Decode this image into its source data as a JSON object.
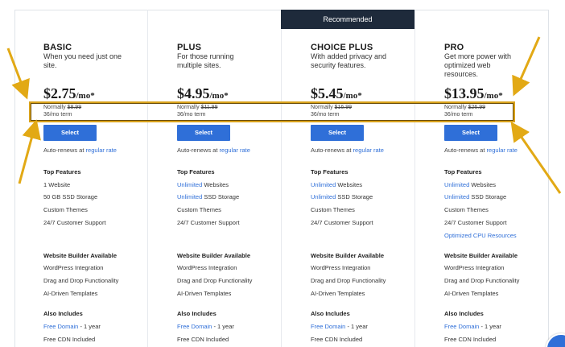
{
  "banner": {
    "recommended": "Recommended"
  },
  "plans": [
    {
      "name": "BASIC",
      "desc": "When you need just one site.",
      "price": "$2.75",
      "per": "/mo*",
      "normally_label": "Normally",
      "normally_price": "$8.99",
      "term": "36/mo term",
      "select": "Select",
      "auto_prefix": "Auto-renews at",
      "auto_link": "regular rate",
      "top_features_title": "Top Features",
      "top_features": [
        {
          "highlight": "",
          "text": "1 Website"
        },
        {
          "highlight": "",
          "text": "50 GB SSD Storage"
        },
        {
          "highlight": "",
          "text": "Custom Themes"
        },
        {
          "highlight": "",
          "text": "24/7 Customer Support"
        }
      ],
      "builder_title": "Website Builder Available",
      "builder": [
        "WordPress Integration",
        "Drag and Drop Functionality",
        "AI-Driven Templates"
      ],
      "also_title": "Also Includes",
      "also": [
        {
          "highlight": "Free Domain",
          "text": " - 1 year"
        },
        {
          "highlight": "",
          "text": "Free CDN Included"
        }
      ]
    },
    {
      "name": "PLUS",
      "desc": "For those running multiple sites.",
      "price": "$4.95",
      "per": "/mo*",
      "normally_label": "Normally",
      "normally_price": "$11.99",
      "term": "36/mo term",
      "select": "Select",
      "auto_prefix": "Auto-renews at",
      "auto_link": "regular rate",
      "top_features_title": "Top Features",
      "top_features": [
        {
          "highlight": "Unlimited",
          "text": " Websites"
        },
        {
          "highlight": "Unlimited",
          "text": " SSD Storage"
        },
        {
          "highlight": "",
          "text": "Custom Themes"
        },
        {
          "highlight": "",
          "text": "24/7 Customer Support"
        }
      ],
      "builder_title": "Website Builder Available",
      "builder": [
        "WordPress Integration",
        "Drag and Drop Functionality",
        "AI-Driven Templates"
      ],
      "also_title": "Also Includes",
      "also": [
        {
          "highlight": "Free Domain",
          "text": " - 1 year"
        },
        {
          "highlight": "",
          "text": "Free CDN Included"
        }
      ]
    },
    {
      "name": "CHOICE PLUS",
      "desc": "With added privacy and security features.",
      "price": "$5.45",
      "per": "/mo*",
      "normally_label": "Normally",
      "normally_price": "$16.99",
      "term": "36/mo term",
      "select": "Select",
      "auto_prefix": "Auto-renews at",
      "auto_link": "regular rate",
      "top_features_title": "Top Features",
      "top_features": [
        {
          "highlight": "Unlimited",
          "text": " Websites"
        },
        {
          "highlight": "Unlimited",
          "text": " SSD Storage"
        },
        {
          "highlight": "",
          "text": "Custom Themes"
        },
        {
          "highlight": "",
          "text": "24/7 Customer Support"
        }
      ],
      "builder_title": "Website Builder Available",
      "builder": [
        "WordPress Integration",
        "Drag and Drop Functionality",
        "AI-Driven Templates"
      ],
      "also_title": "Also Includes",
      "also": [
        {
          "highlight": "Free Domain",
          "text": " - 1 year"
        },
        {
          "highlight": "",
          "text": "Free CDN Included"
        }
      ]
    },
    {
      "name": "PRO",
      "desc": "Get more power with optimized web resources.",
      "price": "$13.95",
      "per": "/mo*",
      "normally_label": "Normally",
      "normally_price": "$26.99",
      "term": "36/mo term",
      "select": "Select",
      "auto_prefix": "Auto-renews at",
      "auto_link": "regular rate",
      "top_features_title": "Top Features",
      "top_features": [
        {
          "highlight": "Unlimited",
          "text": " Websites"
        },
        {
          "highlight": "Unlimited",
          "text": " SSD Storage"
        },
        {
          "highlight": "",
          "text": "Custom Themes"
        },
        {
          "highlight": "",
          "text": "24/7 Customer Support"
        },
        {
          "highlight": "Optimized CPU Resources",
          "text": ""
        }
      ],
      "builder_title": "Website Builder Available",
      "builder": [
        "WordPress Integration",
        "Drag and Drop Functionality",
        "AI-Driven Templates"
      ],
      "also_title": "Also Includes",
      "also": [
        {
          "highlight": "Free Domain",
          "text": " - 1 year"
        },
        {
          "highlight": "",
          "text": "Free CDN Included"
        }
      ]
    }
  ],
  "colors": {
    "accent": "#2f6fd8",
    "banner": "#1e2a3b",
    "annotation": "#d9a21b"
  }
}
